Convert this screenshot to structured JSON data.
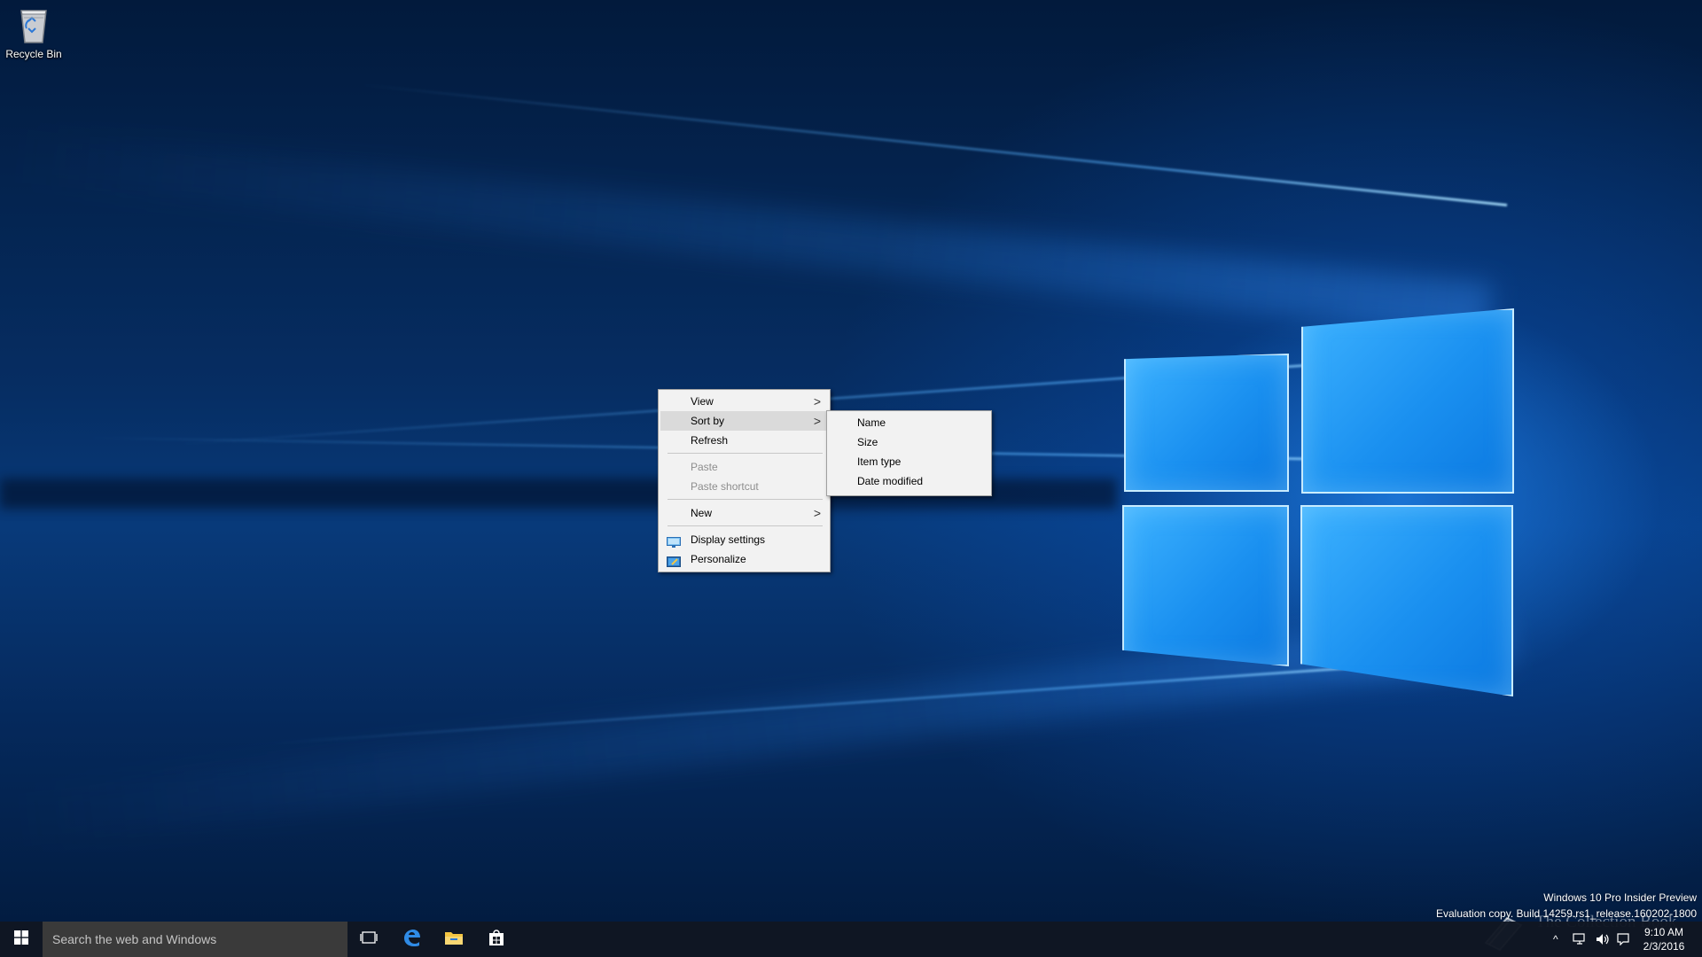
{
  "desktop": {
    "icons": [
      {
        "label": "Recycle Bin",
        "icon": "recycle-bin-icon"
      }
    ]
  },
  "context_menu": {
    "items": [
      {
        "label": "View",
        "has_submenu": true,
        "enabled": true
      },
      {
        "label": "Sort by",
        "has_submenu": true,
        "enabled": true,
        "highlighted": true
      },
      {
        "label": "Refresh",
        "has_submenu": false,
        "enabled": true
      },
      {
        "label": "Paste",
        "has_submenu": false,
        "enabled": false
      },
      {
        "label": "Paste shortcut",
        "has_submenu": false,
        "enabled": false
      },
      {
        "label": "New",
        "has_submenu": true,
        "enabled": true
      },
      {
        "label": "Display settings",
        "icon": "display-settings-icon",
        "enabled": true
      },
      {
        "label": "Personalize",
        "icon": "personalize-icon",
        "enabled": true
      }
    ],
    "arrow_glyph": ">"
  },
  "sort_submenu": {
    "items": [
      {
        "label": "Name"
      },
      {
        "label": "Size"
      },
      {
        "label": "Item type"
      },
      {
        "label": "Date modified"
      }
    ]
  },
  "watermark": {
    "line1": "Windows 10 Pro Insider Preview",
    "line2": "Evaluation copy. Build 14259.rs1_release.160202-1800",
    "collection": "The Collection Book"
  },
  "taskbar": {
    "search_placeholder": "Search the web and Windows",
    "buttons": [
      {
        "name": "task-view",
        "icon": "task-view-icon"
      },
      {
        "name": "edge",
        "icon": "edge-icon"
      },
      {
        "name": "file-explorer",
        "icon": "folder-icon"
      },
      {
        "name": "store",
        "icon": "store-icon"
      }
    ],
    "tray": {
      "chevron": "^",
      "time": "9:10 AM",
      "date": "2/3/2016"
    }
  },
  "colors": {
    "wallpaper_dark": "#021a3c",
    "wallpaper_glow": "#1a90f0",
    "menu_bg": "#f2f2f2",
    "menu_hover": "#dadada",
    "taskbar_bg": "#10161f",
    "search_bg": "#3a3a3a",
    "accent": "#0078d7"
  }
}
